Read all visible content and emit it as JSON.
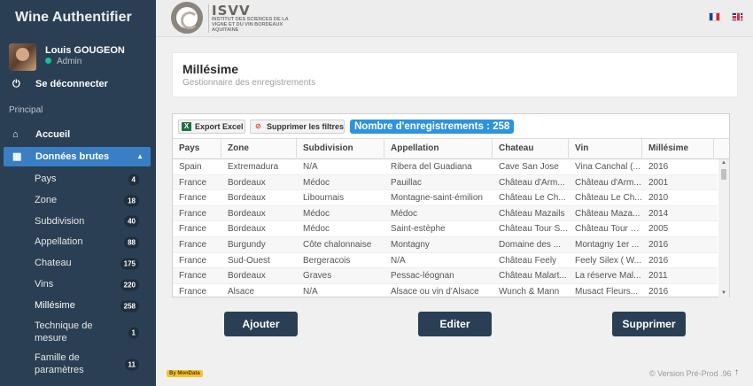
{
  "app": {
    "title": "Wine Authentifier"
  },
  "user": {
    "name": "Louis GOUGEON",
    "role": "Admin"
  },
  "sidebar": {
    "logout_label": "Se déconnecter",
    "section_label": "Principal",
    "home_label": "Accueil",
    "raw_data_label": "Données brutes",
    "items": [
      {
        "label": "Pays",
        "count": "4"
      },
      {
        "label": "Zone",
        "count": "18"
      },
      {
        "label": "Subdivision",
        "count": "40"
      },
      {
        "label": "Appellation",
        "count": "88"
      },
      {
        "label": "Chateau",
        "count": "175"
      },
      {
        "label": "Vins",
        "count": "220"
      },
      {
        "label": "Millésime",
        "count": "258"
      },
      {
        "label": "Technique de mesure",
        "count": "1"
      },
      {
        "label": "Famille de paramètres",
        "count": "11"
      }
    ]
  },
  "header": {
    "logo_title": "ISVV",
    "logo_subtitle": "INSTITUT DES SCIENCES DE LA VIGNE ET DU VIN BORDEAUX AQUITAINE"
  },
  "page": {
    "title": "Millésime",
    "subtitle": "Gestionnaire des enregistrements"
  },
  "toolbar": {
    "export_label": "Export Excel",
    "clear_filters_label": "Supprimer les filtres",
    "record_count": "Nombre d'enregistrements : 258"
  },
  "grid": {
    "columns": [
      "Pays",
      "Zone",
      "Subdivision",
      "Appellation",
      "Chateau",
      "Vin",
      "Millésime"
    ],
    "rows": [
      [
        "Spain",
        "Extremadura",
        "N/A",
        "Ribera del Guadiana",
        "Cave San Jose",
        "Vina Canchal (...",
        "2016"
      ],
      [
        "France",
        "Bordeaux",
        "Médoc",
        "Pauillac",
        "Château d'Arm...",
        "Château d'Arm...",
        "2001"
      ],
      [
        "France",
        "Bordeaux",
        "Libournais",
        "Montagne-saint-émilion",
        "Château Le Ch...",
        "Château Le Ch...",
        "2010"
      ],
      [
        "France",
        "Bordeaux",
        "Médoc",
        "Médoc",
        "Château Mazails",
        "Château Maza...",
        "2014"
      ],
      [
        "France",
        "Bordeaux",
        "Médoc",
        "Saint-estèphe",
        "Château Tour S...",
        "Château Tour S...",
        "2005"
      ],
      [
        "France",
        "Burgundy",
        "Côte chalonnaise",
        "Montagny",
        "Domaine des ...",
        "Montagny 1er ...",
        "2016"
      ],
      [
        "France",
        "Sud-Ouest",
        "Bergeracois",
        "N/A",
        "Château Feely",
        "Feely Silex ( W...",
        "2016"
      ],
      [
        "France",
        "Bordeaux",
        "Graves",
        "Pessac-léognan",
        "Château Malart...",
        "La réserve Mal...",
        "2011"
      ],
      [
        "France",
        "Alsace",
        "N/A",
        "Alsace ou vin d'Alsace",
        "Wunch & Mann",
        "Musact Fleurs...",
        "2016"
      ]
    ]
  },
  "actions": {
    "add_label": "Ajouter",
    "edit_label": "Editer",
    "delete_label": "Supprimer"
  },
  "footer": {
    "badge": "By MonData",
    "version": "© Version Pré-Prod .96",
    "scroll_top": "↑"
  },
  "colors": {
    "sidebar_bg": "#2a3f54",
    "active_nav": "#3a7fc4",
    "count_badge": "#2e93e0",
    "status_online": "#1abb9c"
  }
}
